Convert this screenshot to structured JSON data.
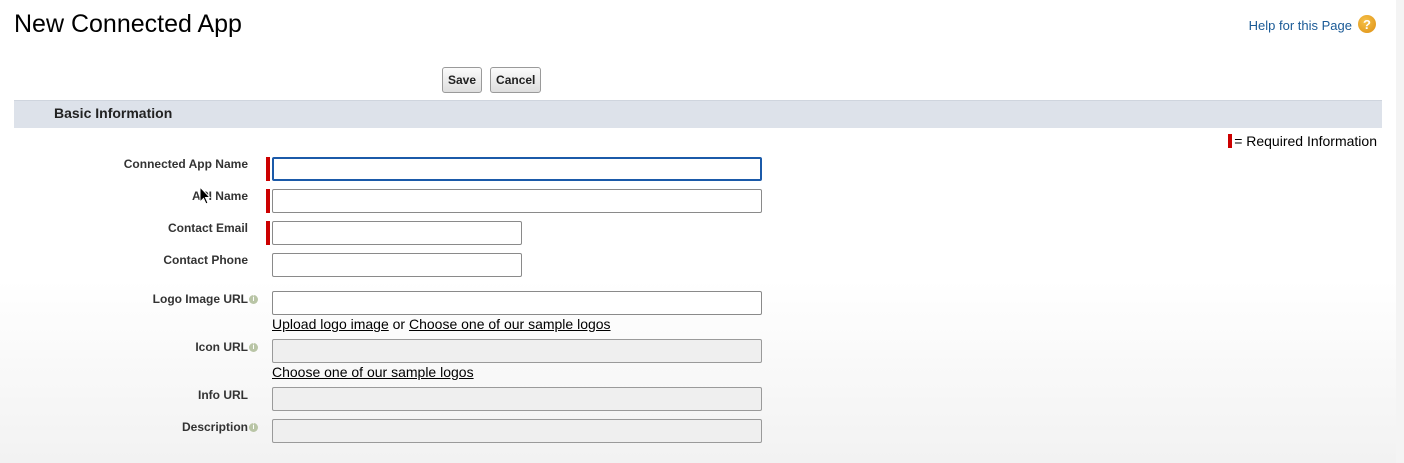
{
  "header": {
    "title": "New Connected App",
    "help_link": "Help for this Page",
    "help_icon": "?"
  },
  "toolbar": {
    "save_label": "Save",
    "cancel_label": "Cancel"
  },
  "section": {
    "title": "Basic Information",
    "required_legend": "= Required Information"
  },
  "fields": {
    "connected_app_name": {
      "label": "Connected App Name",
      "value": ""
    },
    "api_name": {
      "label": "API Name",
      "value": ""
    },
    "contact_email": {
      "label": "Contact Email",
      "value": ""
    },
    "contact_phone": {
      "label": "Contact Phone",
      "value": ""
    },
    "logo_image_url": {
      "label": "Logo Image URL",
      "value": "",
      "upload_link": "Upload logo image",
      "or_text": "or",
      "sample_link": "Choose one of our sample logos"
    },
    "icon_url": {
      "label": "Icon URL",
      "value": "",
      "sample_link": "Choose one of our sample logos"
    },
    "info_url": {
      "label": "Info URL",
      "value": ""
    },
    "description": {
      "label": "Description",
      "value": ""
    }
  },
  "colors": {
    "required": "#cc0000",
    "link": "#1a5a96",
    "section_bg": "#dde2ea",
    "focus": "#1b5aa9"
  }
}
